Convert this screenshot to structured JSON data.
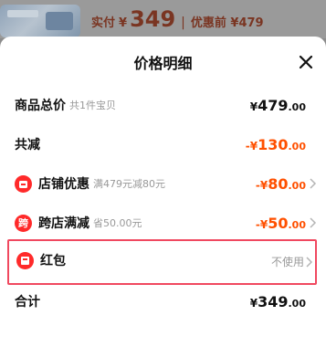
{
  "background": {
    "price_label": "实付",
    "price_symbol": "¥",
    "price_value": "349",
    "separator": "|",
    "original_price": "优惠前 ¥479"
  },
  "sheet": {
    "title": "价格明细",
    "rows": [
      {
        "label": "商品总价",
        "sub": "共1件宝贝",
        "sym": "¥",
        "int": "479",
        "dec": ".00"
      },
      {
        "label": "共减",
        "sub": "",
        "sym": "-¥",
        "int": "130",
        "dec": ".00"
      },
      {
        "label": "店铺优惠",
        "sub": "满479元减80元",
        "sym": "-¥",
        "int": "80",
        "dec": ".00",
        "badge": ""
      },
      {
        "label": "跨店满减",
        "sub": "省50.00元",
        "sym": "-¥",
        "int": "50",
        "dec": ".00",
        "badge": "跨"
      }
    ],
    "redpack": {
      "label": "红包",
      "status": "不使用"
    },
    "total": {
      "label": "合计",
      "sym": "¥",
      "int": "349",
      "dec": ".00"
    }
  },
  "colors": {
    "accent_red": "#ff5000",
    "badge_red": "#ff2a2a",
    "highlight_border": "#f0485f"
  },
  "icons": [
    "close-icon",
    "shop-icon",
    "cross-store-icon",
    "red-packet-icon",
    "chevron-right-icon"
  ]
}
